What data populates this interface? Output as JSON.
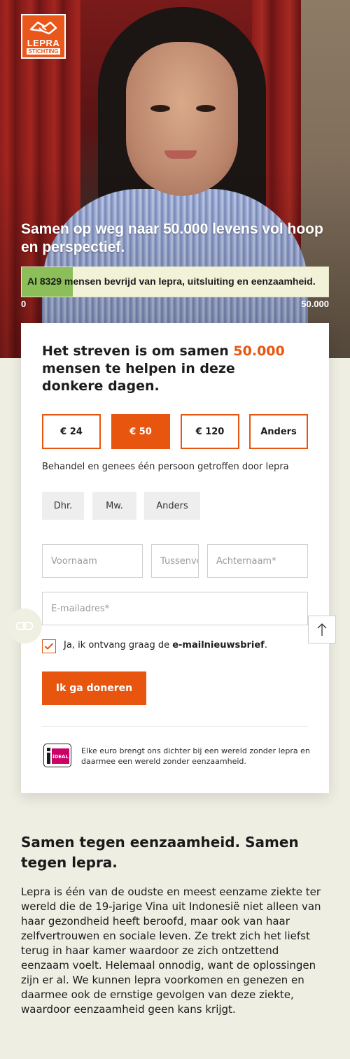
{
  "logo": {
    "line1": "LEPRA",
    "line2": "STICHTING",
    "color": "#e9571a"
  },
  "hero": {
    "title": "Samen op weg naar 50.000 levens vol hoop en perspectief."
  },
  "progress": {
    "text": "Al 8329 mensen bevrijd van lepra, uitsluiting en eenzaamheid.",
    "current": 8329,
    "goal": 50000,
    "fraction": 0.1666,
    "min_label": "0",
    "max_label": "50.000",
    "fill_color": "#8cbf5a"
  },
  "form": {
    "title_before": "Het streven is om samen ",
    "title_accent": "50.000",
    "title_after": " mensen te helpen in deze donkere dagen.",
    "amounts": [
      {
        "label": "€ 24",
        "selected": false
      },
      {
        "label": "€ 50",
        "selected": true
      },
      {
        "label": "€ 120",
        "selected": false
      },
      {
        "label": "Anders",
        "selected": false
      }
    ],
    "amount_description": "Behandel en genees één persoon getroffen door lepra",
    "salutations": [
      "Dhr.",
      "Mw.",
      "Anders"
    ],
    "fields": {
      "firstname_placeholder": "Voornaam",
      "infix_placeholder": "Tussenvoegsel",
      "lastname_placeholder": "Achternaam*",
      "email_placeholder": "E-mailadres*"
    },
    "newsletter": {
      "checked": true,
      "text_before": "Ja, ik ontvang graag de ",
      "text_bold": "e-mailnieuwsbrief",
      "text_after": "."
    },
    "submit_label": "Ik ga doneren",
    "ideal_label": "iDEAL",
    "footer_text": "Elke euro brengt ons dichter bij een wereld zonder lepra en daarmee een wereld zonder eenzaamheid.",
    "accent_color": "#e8550f"
  },
  "floating": {
    "left_icon": "link-icon",
    "right_icon": "arrow-up-icon"
  },
  "article": {
    "title": "Samen tegen eenzaamheid. Samen tegen lepra.",
    "body": "Lepra is één van de oudste en meest eenzame ziekte ter wereld die de 19-jarige Vina uit Indonesië niet alleen van haar gezondheid heeft beroofd, maar ook van haar zelfvertrouwen en sociale leven. Ze trekt zich het liefst terug in haar kamer waardoor ze zich ontzettend eenzaam voelt. Helemaal onnodig, want de oplossingen zijn er al. We kunnen lepra voorkomen en genezen en daarmee ook de ernstige gevolgen van deze ziekte, waardoor eenzaamheid geen kans krijgt."
  }
}
